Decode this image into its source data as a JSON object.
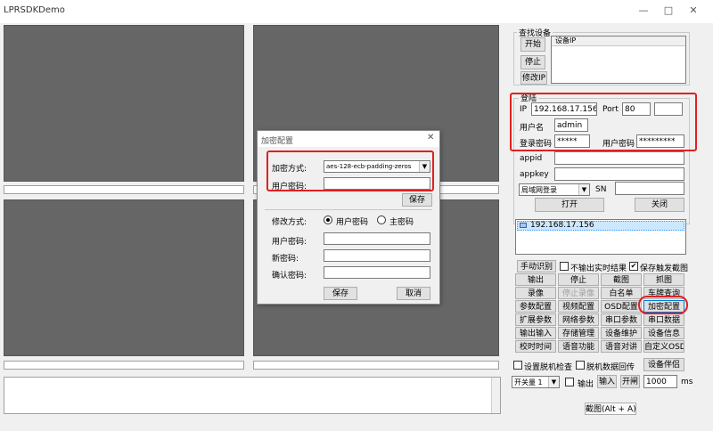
{
  "window": {
    "title": "LPRSDKDemo",
    "minimize": "—",
    "maximize": "□",
    "close": "✕"
  },
  "device_search": {
    "label": "查找设备",
    "start": "开始",
    "stop": "停止",
    "modify_ip": "修改IP",
    "list_header": "设备IP"
  },
  "login": {
    "label": "登陆",
    "ip_label": "IP",
    "ip_value": "192.168.17.156",
    "port_label": "Port",
    "port_value": "80",
    "extra_value": "",
    "username_label": "用户名",
    "username_value": "admin",
    "login_password_label": "登录密码",
    "login_password_value": "*****",
    "user_password_label": "用户密码",
    "user_password_value": "*********",
    "appid_label": "appid",
    "appid_value": "",
    "appkey_label": "appkey",
    "appkey_value": "",
    "mode_value": "局域网登录",
    "sn_label": "SN",
    "sn_value": "",
    "open": "打开",
    "close": "关闭"
  },
  "device_list": [
    "192.168.17.156"
  ],
  "options": {
    "manual_recognize": "手动识别",
    "no_realtime_output": "不输出实时结果",
    "save_trigger_image": "保存触发截图",
    "save_trigger_checked": "✔"
  },
  "buttons": [
    [
      "输出",
      "停止",
      "截图",
      "抓图"
    ],
    [
      "录像",
      "停止录像",
      "白名单",
      "车牌查询"
    ],
    [
      "参数配置",
      "视频配置",
      "OSD配置",
      "加密配置"
    ],
    [
      "扩展参数",
      "网络参数",
      "串口参数",
      "串口数据"
    ],
    [
      "输出输入",
      "存储管理",
      "设备维护",
      "设备信息"
    ],
    [
      "校时时间",
      "语音功能",
      "语音对讲",
      "自定义OSD"
    ]
  ],
  "bottom": {
    "offline_check": "设置脱机检查",
    "offline_upload": "脱机数据回传",
    "device_companion": "设备伴侣",
    "switch_value": "开关量 1",
    "output_label": "输出",
    "input_btn": "输入",
    "open_btn": "开闸",
    "interval_value": "1000",
    "unit": "ms",
    "screenshot": "截图(Alt + A)"
  },
  "dialog": {
    "title": "加密配置",
    "close": "✕",
    "encrypt_mode_label": "加密方式:",
    "encrypt_mode_value": "aes-128-ecb-padding-zeros",
    "user_password_label": "用户密码:",
    "user_password_value": "",
    "save": "保存",
    "modify_mode_label": "修改方式:",
    "radio_user_password": "用户密码",
    "radio_main_password": "主密码",
    "user_password2_label": "用户密码:",
    "new_password_label": "新密码:",
    "confirm_password_label": "确认密码:",
    "save2": "保存",
    "cancel": "取消"
  },
  "colors": {
    "highlight": "#e02020",
    "video_bg": "#666666"
  }
}
